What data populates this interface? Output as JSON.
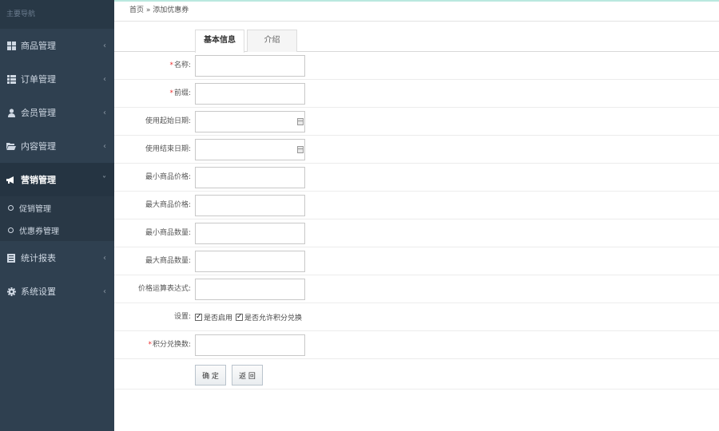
{
  "sidebar": {
    "header": "主要导航",
    "items": [
      {
        "label": "商品管理",
        "arrow": "‹"
      },
      {
        "label": "订单管理",
        "arrow": "‹"
      },
      {
        "label": "会员管理",
        "arrow": "‹"
      },
      {
        "label": "内容管理",
        "arrow": "‹"
      },
      {
        "label": "营销管理",
        "arrow": "˅"
      },
      {
        "label": "统计报表",
        "arrow": "‹"
      },
      {
        "label": "系统设置",
        "arrow": "‹"
      }
    ],
    "sub_items": [
      {
        "label": "促销管理"
      },
      {
        "label": "优惠券管理"
      }
    ]
  },
  "breadcrumb": "首页 » 添加优惠券",
  "tabs": [
    {
      "label": "基本信息",
      "active": true
    },
    {
      "label": "介绍",
      "active": false
    }
  ],
  "form": {
    "name": {
      "label": "名称:",
      "required": "*",
      "value": ""
    },
    "prefix": {
      "label": "前缀:",
      "required": "*",
      "value": ""
    },
    "start_date": {
      "label": "使用起始日期:",
      "value": ""
    },
    "end_date": {
      "label": "使用结束日期:",
      "value": ""
    },
    "min_price": {
      "label": "最小商品价格:",
      "value": ""
    },
    "max_price": {
      "label": "最大商品价格:",
      "value": ""
    },
    "min_qty": {
      "label": "最小商品数量:",
      "value": ""
    },
    "max_qty": {
      "label": "最大商品数量:",
      "value": ""
    },
    "price_expr": {
      "label": "价格运算表达式:",
      "value": ""
    },
    "settings": {
      "label": "设置:",
      "option1": "是否启用",
      "option2": "是否允许积分兑换"
    },
    "points": {
      "label": "积分兑换数:",
      "required": "*",
      "value": ""
    }
  },
  "buttons": {
    "ok": "确 定",
    "back": "返 回"
  }
}
